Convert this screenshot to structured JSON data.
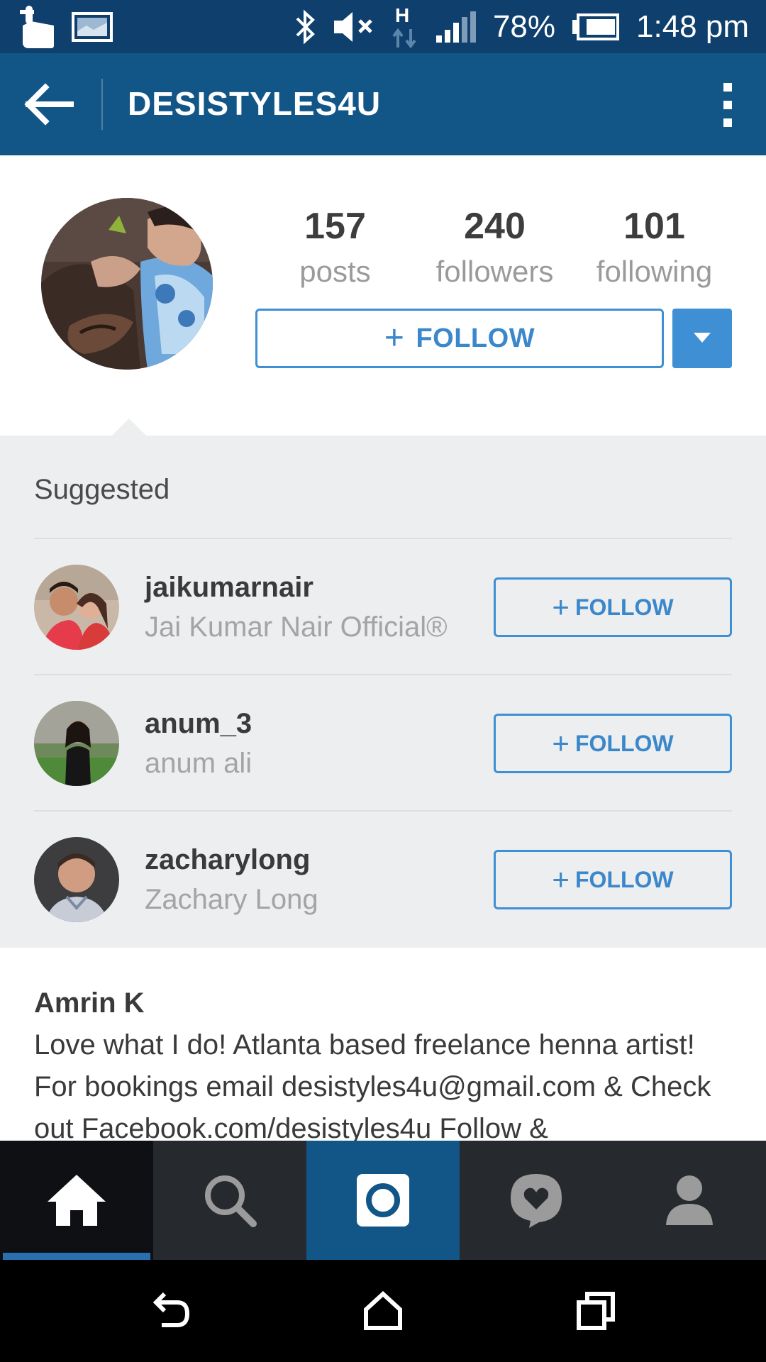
{
  "status_bar": {
    "battery": "78%",
    "time": "1:48 pm",
    "network": "H",
    "icons": [
      "touch-icon",
      "image-icon",
      "bluetooth-icon",
      "mute-icon",
      "h-network-icon",
      "signal-icon",
      "battery-icon"
    ]
  },
  "app_bar": {
    "title": "DESISTYLES4U",
    "icons": [
      "back-arrow-icon",
      "overflow-menu-icon"
    ]
  },
  "profile": {
    "stats": [
      {
        "value": "157",
        "label": "posts"
      },
      {
        "value": "240",
        "label": "followers"
      },
      {
        "value": "101",
        "label": "following"
      }
    ],
    "follow_label": "FOLLOW"
  },
  "suggested": {
    "title": "Suggested",
    "items": [
      {
        "username": "jaikumarnair",
        "name": "Jai Kumar Nair Official®",
        "follow_label": "FOLLOW"
      },
      {
        "username": "anum_3",
        "name": "anum ali",
        "follow_label": "FOLLOW"
      },
      {
        "username": "zacharylong",
        "name": "Zachary Long",
        "follow_label": "FOLLOW"
      }
    ]
  },
  "bio": {
    "name": "Amrin K",
    "text": "Love what I do! Atlanta based freelance henna artist! For bookings email desistyles4u@gmail.com & Check out Facebook.com/desistyles4u Follow &"
  },
  "tab_bar": {
    "tabs": [
      "home-icon",
      "search-icon",
      "camera-icon",
      "activity-icon",
      "profile-icon"
    ],
    "active": "home-icon"
  },
  "colors": {
    "status_bar": "#0f3f6c",
    "app_bar": "#125688",
    "accent": "#3f8fd4",
    "suggested_bg": "#eceeef"
  }
}
